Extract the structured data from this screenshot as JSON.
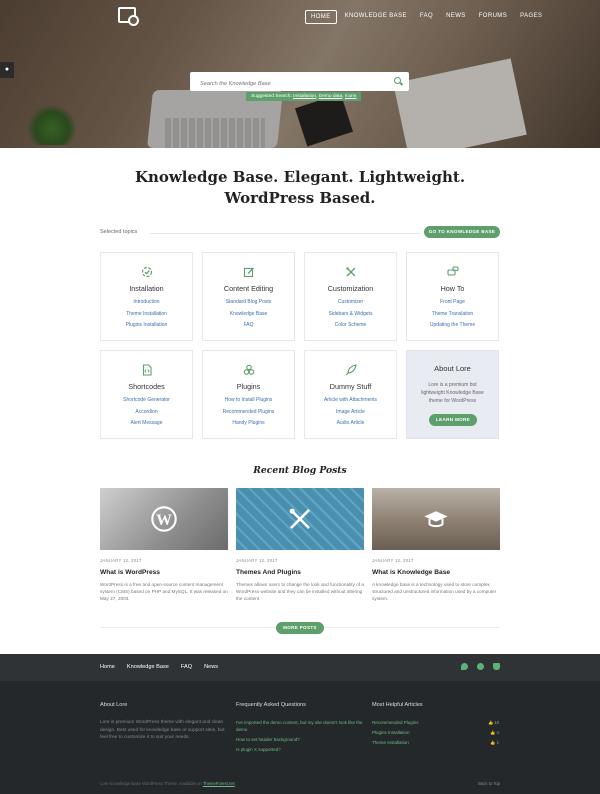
{
  "nav": {
    "items": [
      "HOME",
      "KNOWLEDGE BASE",
      "FAQ",
      "NEWS",
      "FORUMS",
      "PAGES"
    ],
    "active": "HOME"
  },
  "search": {
    "placeholder": "Search the Knowledge Base",
    "suggest_prefix": "Suggested Search:",
    "suggest_terms": [
      "Installation",
      "Demo data",
      "Icons"
    ]
  },
  "headline": {
    "line1": "Knowledge Base. Elegant. Lightweight.",
    "line2": "WordPress Based."
  },
  "topics": {
    "label": "Selected topics",
    "button": "GO TO KNOWLEDGE BASE",
    "cards": [
      {
        "icon": "check-badge-icon",
        "title": "Installation",
        "links": [
          "Introduction",
          "Theme Installation",
          "Plugins Installation"
        ]
      },
      {
        "icon": "edit-icon",
        "title": "Content Editing",
        "links": [
          "Standard Blog Posts",
          "Knowledge Base",
          "FAQ"
        ]
      },
      {
        "icon": "tools-icon",
        "title": "Customization",
        "links": [
          "Customizer",
          "Sidebars & Widgets",
          "Color Scheme"
        ]
      },
      {
        "icon": "chat-icon",
        "title": "How To",
        "links": [
          "Front Page",
          "Theme Translation",
          "Updating the Theme"
        ]
      },
      {
        "icon": "code-file-icon",
        "title": "Shortcodes",
        "links": [
          "Shortcode Generator",
          "Accordion",
          "Alert Message"
        ]
      },
      {
        "icon": "plugin-icon",
        "title": "Plugins",
        "links": [
          "How to Install Plugins",
          "Recommended Plugins",
          "Handy Plugins"
        ]
      },
      {
        "icon": "rocket-icon",
        "title": "Dummy Stuff",
        "links": [
          "Article with Attachments",
          "Image Article",
          "Audio Article"
        ]
      }
    ],
    "about": {
      "title": "About Lore",
      "text": "Lore is a premium but lightweight Knowledge Base theme for WordPress",
      "button": "LEARN MORE"
    }
  },
  "blog": {
    "title": "Recent Blog Posts",
    "posts": [
      {
        "date": "JANUARY 12, 2017",
        "title": "What is WordPress",
        "icon": "wordpress-icon",
        "excerpt": "WordPress is a free and open-source content management system (CMS) based on PHP and MySQL. It was released on May 27, 2003."
      },
      {
        "date": "JANUARY 12, 2017",
        "title": "Themes And Plugins",
        "icon": "tools-icon",
        "excerpt": "Themes allows users to change the look and functionality of a WordPress website and they can be installed without altering the content"
      },
      {
        "date": "JANUARY 12, 2017",
        "title": "What is Knowledge Base",
        "icon": "graduation-cap-icon",
        "excerpt": "A knowledge base is a technology used to store complex structured and unstructured information used by a computer system."
      }
    ],
    "more_button": "MORE POSTS"
  },
  "footer": {
    "nav": [
      "Home",
      "Knowledge Base",
      "FAQ",
      "News"
    ],
    "social": [
      "twitter-icon",
      "github-icon",
      "bitbucket-icon"
    ],
    "about_title": "About Lore",
    "about_text": "Lore is premium WordPress theme with elegant and clean design. Best used for knowledge base or support sites, but feel free to customize it to suit your needs.",
    "faq_title": "Frequently Asked Questions",
    "faq_items": [
      "I've imported the demo content, but my site doesn't look like the demo",
      "How to set header background?",
      "Is plugin X supported?"
    ],
    "articles_title": "Most Helpful Articles",
    "articles": [
      {
        "title": "Recommended Plugins",
        "count": "10"
      },
      {
        "title": "Plugins Installation",
        "count": "4"
      },
      {
        "title": "Theme Installation",
        "count": "1"
      }
    ],
    "copyright_prefix": "Lore Knowledge Base WordPress Theme. Available on",
    "copyright_link": "ThemeForest.net",
    "back_to_top": "Back to Top"
  },
  "colors": {
    "accent": "#5e9f6c",
    "link": "#3a6fb0",
    "footer_dark": "#24282b"
  }
}
